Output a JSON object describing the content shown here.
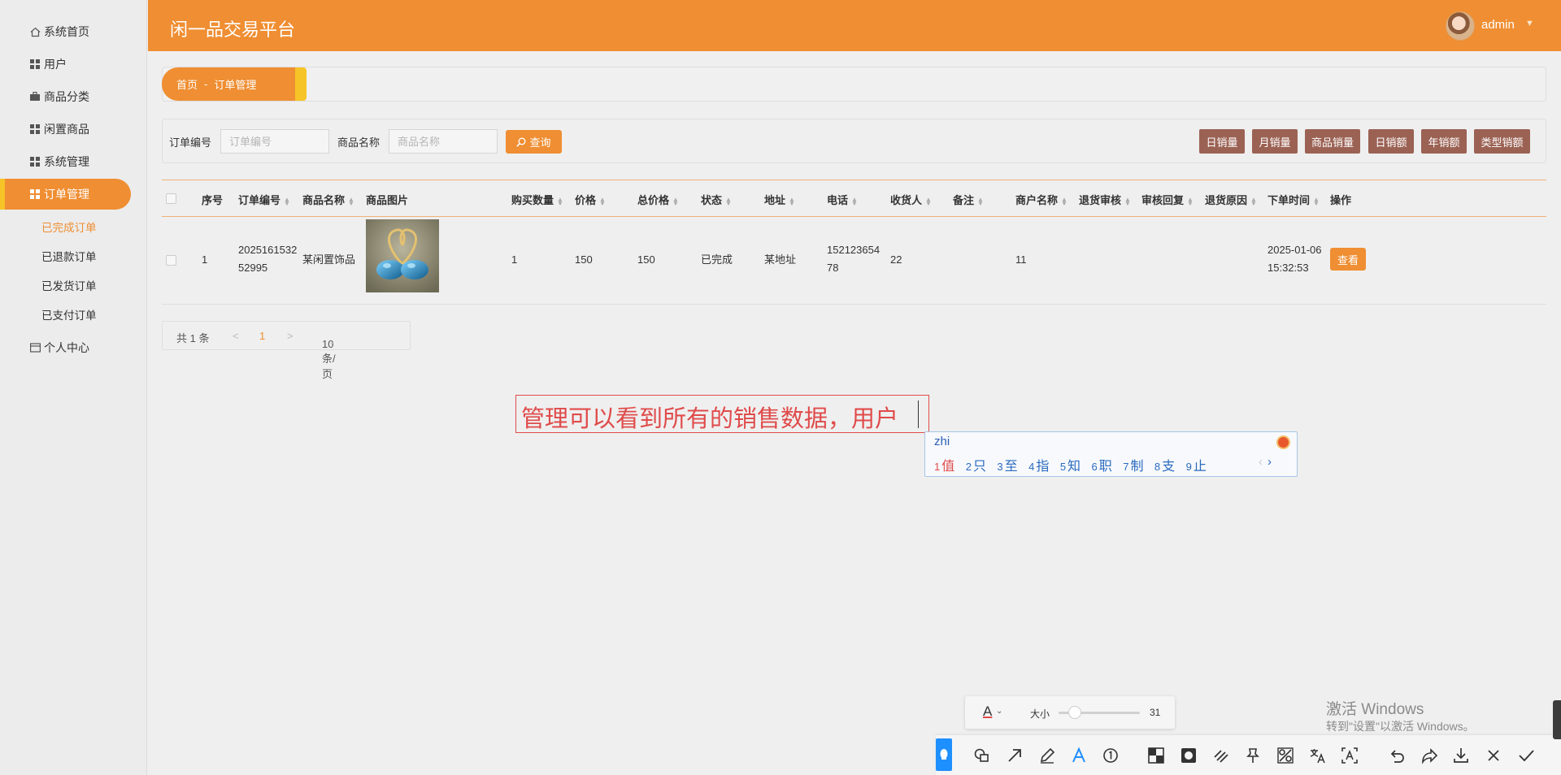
{
  "app": {
    "title": "闲一品交易平台",
    "user": "admin"
  },
  "sidebar": {
    "items": [
      {
        "label": "系统首页",
        "icon": "home-icon"
      },
      {
        "label": "用户",
        "icon": "grid-icon"
      },
      {
        "label": "商品分类",
        "icon": "briefcase-icon"
      },
      {
        "label": "闲置商品",
        "icon": "grid-icon"
      },
      {
        "label": "系统管理",
        "icon": "grid-icon"
      },
      {
        "label": "订单管理",
        "icon": "grid-icon"
      },
      {
        "label": "个人中心",
        "icon": "card-icon"
      }
    ],
    "sub_items": [
      "已完成订单",
      "已退款订单",
      "已发货订单",
      "已支付订单"
    ]
  },
  "breadcrumb": {
    "home": "首页",
    "separator": "-",
    "current": "订单管理"
  },
  "search": {
    "order_no_label": "订单编号",
    "order_no_placeholder": "订单编号",
    "product_name_label": "商品名称",
    "product_name_placeholder": "商品名称",
    "query_label": "查询"
  },
  "stat_buttons": [
    "日销量",
    "月销量",
    "商品销量",
    "日销额",
    "年销额",
    "类型销额"
  ],
  "table": {
    "columns": [
      "序号",
      "订单编号",
      "商品名称",
      "商品图片",
      "购买数量",
      "价格",
      "总价格",
      "状态",
      "地址",
      "电话",
      "收货人",
      "备注",
      "商户名称",
      "退货审核",
      "审核回复",
      "退货原因",
      "下单时间",
      "操作"
    ],
    "rows": [
      {
        "index": "1",
        "order_no": [
          "2025161532",
          "52995"
        ],
        "product_name": "某闲置饰品",
        "quantity": "1",
        "price": "150",
        "total": "150",
        "status": "已完成",
        "address": "某地址",
        "phone": [
          "152123654",
          "78"
        ],
        "receiver": "22",
        "remark": "",
        "merchant": "11",
        "return_review": "",
        "review_reply": "",
        "return_reason": "",
        "order_time": [
          "2025-01-06",
          "15:32:53"
        ],
        "action": "查看"
      }
    ]
  },
  "pager": {
    "total": "共 1 条",
    "prev": "<",
    "page": "1",
    "next": ">",
    "page_size": "10条/页"
  },
  "annotation": {
    "text": "管理可以看到所有的销售数据，用户"
  },
  "ime": {
    "input": "zhi",
    "candidates": [
      {
        "n": "1",
        "c": "值"
      },
      {
        "n": "2",
        "c": "只"
      },
      {
        "n": "3",
        "c": "至"
      },
      {
        "n": "4",
        "c": "指"
      },
      {
        "n": "5",
        "c": "知"
      },
      {
        "n": "6",
        "c": "职"
      },
      {
        "n": "7",
        "c": "制"
      },
      {
        "n": "8",
        "c": "支"
      },
      {
        "n": "9",
        "c": "止"
      }
    ],
    "prev": "‹",
    "next": "›"
  },
  "size_panel": {
    "color_glyph": "A",
    "caret": "⌄",
    "label": "大小",
    "value": "31",
    "slider_fraction": 0.2
  },
  "watermark": {
    "line1": "激活 Windows",
    "line2": "转到\"设置\"以激活 Windows。"
  },
  "colors": {
    "accent": "#ef8e32",
    "accent_yellow": "#f6c426",
    "stat_button": "#9b6254",
    "annotation": "#e04b4b",
    "screenshot_pin": "#1e8fff"
  }
}
